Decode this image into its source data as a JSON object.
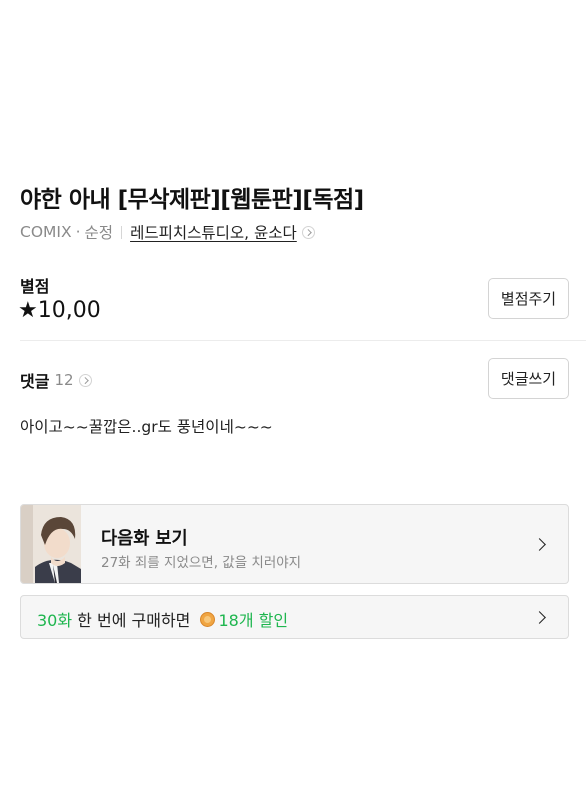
{
  "work": {
    "title": "야한 아내 [무삭제판][웹툰판][독점]",
    "publisher": "COMIX",
    "genre": "순정",
    "authors": "레드피치스튜디오, 윤소다"
  },
  "rating": {
    "label": "별점",
    "star": "★",
    "value": "10,00",
    "button_label": "별점주기"
  },
  "comments": {
    "label": "댓글",
    "count": "12",
    "button_label": "댓글쓰기",
    "latest": "아이고~~꿀깝은..gr도 풍년이네~~~"
  },
  "next_episode": {
    "title": "다음화 보기",
    "subtitle": "27화 죄를 지었으면, 값을 치러야지"
  },
  "promo": {
    "episodes": "30화",
    "text": " 한 번에 구매하면 ",
    "discount": "18개 할인"
  }
}
